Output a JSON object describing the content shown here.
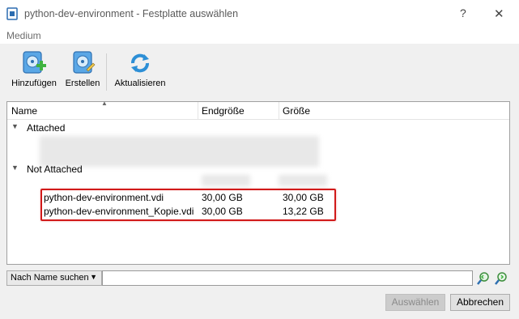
{
  "window": {
    "title": "python-dev-environment - Festplatte auswählen",
    "help": "?",
    "close": "✕"
  },
  "menu": {
    "medium": "Medium"
  },
  "toolbar": {
    "add_label": "Hinzufügen",
    "create_label": "Erstellen",
    "refresh_label": "Aktualisieren"
  },
  "table": {
    "columns": {
      "name": "Name",
      "virtual_size": "Endgröße",
      "actual_size": "Größe"
    },
    "groups": {
      "attached": "Attached",
      "not_attached": "Not Attached"
    },
    "disks": [
      {
        "name": "python-dev-environment.vdi",
        "virtual_size": "30,00 GB",
        "actual_size": "30,00 GB"
      },
      {
        "name": "python-dev-environment_Kopie.vdi",
        "virtual_size": "30,00 GB",
        "actual_size": "13,22 GB"
      }
    ]
  },
  "search": {
    "mode_selected": "Nach Name suchen",
    "value": ""
  },
  "buttons": {
    "select": "Auswählen",
    "cancel": "Abbrechen"
  },
  "colors": {
    "highlight": "#d11a1a",
    "icon_blue": "#3a8fd6",
    "add_green": "#3fb33f"
  }
}
